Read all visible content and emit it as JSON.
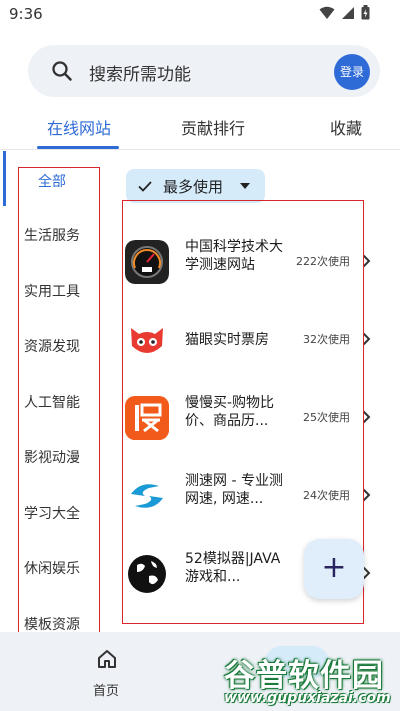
{
  "status_bar": {
    "time": "9:36"
  },
  "search": {
    "placeholder": "搜索所需功能",
    "login_label": "登录"
  },
  "tabs": [
    {
      "label": "在线网站",
      "active": true
    },
    {
      "label": "贡献排行",
      "active": false
    },
    {
      "label": "收藏",
      "active": false
    }
  ],
  "sidebar": {
    "items": [
      {
        "label": "全部",
        "active": true
      },
      {
        "label": "生活服务"
      },
      {
        "label": "实用工具"
      },
      {
        "label": "资源发现"
      },
      {
        "label": "人工智能"
      },
      {
        "label": "影视动漫"
      },
      {
        "label": "学习大全"
      },
      {
        "label": "休闲娱乐"
      },
      {
        "label": "模板资源"
      }
    ]
  },
  "filter": {
    "label": "最多使用"
  },
  "list": [
    {
      "title": "中国科学技术大学测速网站",
      "usage": "222次使用",
      "icon": "speedometer-icon"
    },
    {
      "title": "猫眼实时票房",
      "usage": "32次使用",
      "icon": "cat-eye-icon"
    },
    {
      "title": "慢慢买-购物比价、商品历...",
      "usage": "25次使用",
      "icon": "manmanmai-icon"
    },
    {
      "title": "测速网 - 专业测网速, 网速...",
      "usage": "24次使用",
      "icon": "speedtest-s-icon"
    },
    {
      "title": "52模拟器|JAVA游戏和...",
      "usage": "",
      "icon": "globe-icon"
    }
  ],
  "bottom_nav": {
    "home_label": "首页"
  },
  "watermark": {
    "main": "谷普软件园",
    "url": "www.gupuxiazai.com"
  },
  "colors": {
    "accent": "#2f6bd6",
    "annotation_red": "#d9262c",
    "chip_bg": "#d6ebfa"
  }
}
